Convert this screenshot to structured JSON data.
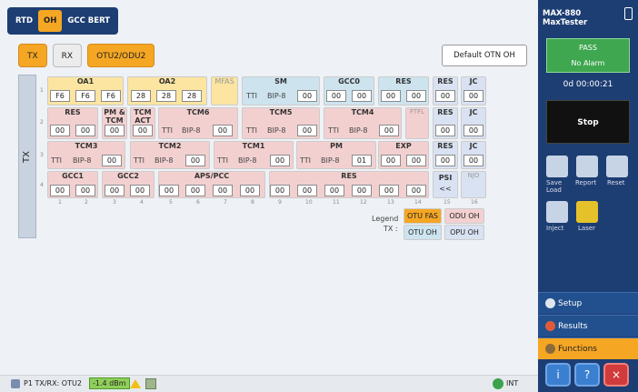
{
  "top_tabs": [
    "RTD",
    "OH",
    "GCC BERT"
  ],
  "sub_tabs": [
    "TX",
    "RX",
    "OTU2/ODU2"
  ],
  "default_button": "Default OTN OH",
  "side_label": "TX",
  "rows": [
    {
      "num": "1",
      "headers": [
        "OA1",
        "OA2",
        "MFAS",
        "SM",
        "GCC0",
        "RES",
        "RES",
        "JC"
      ],
      "values": [
        "F6",
        "F6",
        "F6",
        "28",
        "28",
        "28",
        "TTI",
        "BIP-8",
        "00",
        "00",
        "00",
        "00",
        "00",
        "00",
        "00"
      ]
    },
    {
      "num": "2",
      "headers": [
        "RES",
        "PM & TCM",
        "TCM ACT",
        "TCM6",
        "TCM5",
        "TCM4",
        "FTFL",
        "RES",
        "JC"
      ],
      "values": [
        "00",
        "00",
        "00",
        "00",
        "TTI",
        "BIP-8",
        "00",
        "TTI",
        "BIP-8",
        "00",
        "TTI",
        "BIP-8",
        "00",
        "00",
        "00"
      ]
    },
    {
      "num": "3",
      "headers": [
        "TCM3",
        "TCM2",
        "TCM1",
        "PM",
        "EXP",
        "RES",
        "JC"
      ],
      "values": [
        "TTI",
        "BIP-8",
        "00",
        "TTI",
        "BIP-8",
        "00",
        "TTI",
        "BIP-8",
        "00",
        "TTI",
        "BIP-8",
        "01",
        "00",
        "00",
        "00",
        "00"
      ]
    },
    {
      "num": "4",
      "headers": [
        "GCC1",
        "GCC2",
        "APS/PCC",
        "RES",
        "PSI",
        "NJO"
      ],
      "values": [
        "00",
        "00",
        "00",
        "00",
        "00",
        "00",
        "00",
        "00",
        "00",
        "00",
        "00",
        "00",
        "00",
        "00",
        "<<"
      ]
    }
  ],
  "col_numbers": [
    "1",
    "2",
    "3",
    "4",
    "5",
    "6",
    "7",
    "8",
    "9",
    "10",
    "11",
    "12",
    "13",
    "14",
    "15",
    "16"
  ],
  "legend": {
    "title": "Legend",
    "sub": "TX :",
    "items": [
      "OTU FAS",
      "ODU OH",
      "OTU OH",
      "OPU OH"
    ],
    "colors": [
      "#f5a623",
      "#f3d0d0",
      "#cde4ef",
      "#d9e2f3"
    ]
  },
  "device": {
    "model": "MAX-880",
    "name": "MaxTester"
  },
  "status": {
    "pass": "PASS",
    "alarm": "No Alarm",
    "timer": "0d 00:00:21",
    "stop": "Stop"
  },
  "tools": [
    {
      "label": "Save Load",
      "icon": "save-load-icon"
    },
    {
      "label": "Report",
      "icon": "report-icon"
    },
    {
      "label": "Reset",
      "icon": "reset-icon"
    },
    {
      "label": "Inject",
      "icon": "inject-icon"
    },
    {
      "label": "Laser",
      "icon": "laser-icon"
    }
  ],
  "menu": [
    "Setup",
    "Results",
    "Functions"
  ],
  "footer": {
    "port": "P1 TX/RX: OTU2",
    "power": "-1.4 dBm",
    "int": "INT"
  }
}
